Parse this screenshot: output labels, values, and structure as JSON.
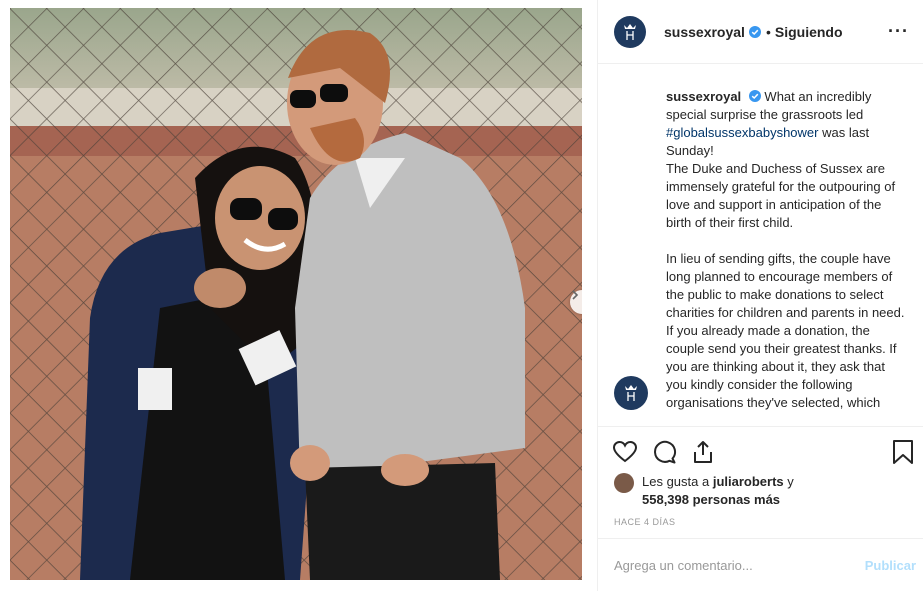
{
  "post": {
    "username": "sussexroyal",
    "follow_status": "Siguiendo",
    "separator": "•",
    "more_label": "···"
  },
  "caption": {
    "username": "sussexroyal",
    "line1": "What an incredibly special surprise the grassroots led ",
    "hashtag": "#globalsussexbabyshower",
    "line1_end": " was last Sunday!",
    "para2": "The Duke and Duchess of Sussex are immensely grateful for the outpouring of love and support in anticipation of the birth of their first child.",
    "para3": "In lieu of sending gifts, the couple have long planned to encourage members of the public to make donations to select charities for children and parents in need. If you already made a donation, the couple send you their greatest thanks. If you are thinking about it, they ask that you kindly consider the following organisations they've selected, which"
  },
  "likes": {
    "prefix": "Les gusta a ",
    "user": "juliaroberts",
    "mid": " y",
    "count": "558,398 personas más"
  },
  "timestamp": "HACE 4 DÍAS",
  "comment_box": {
    "placeholder": "Agrega un comentario...",
    "publish_label": "Publicar"
  },
  "carousel": {
    "slides": 5,
    "active_index": 0
  },
  "icons": [
    "heart-icon",
    "comment-icon",
    "share-icon",
    "bookmark-icon",
    "verified-badge-icon",
    "next-arrow-icon"
  ],
  "colors": {
    "link": "#003569",
    "verified": "#3897f0",
    "publish_disabled": "#b2dffc",
    "muted": "#999999"
  }
}
